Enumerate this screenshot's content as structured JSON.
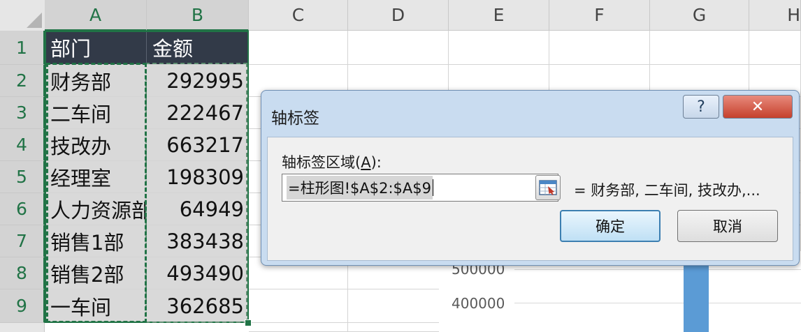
{
  "columns": [
    "A",
    "B",
    "C",
    "D",
    "E",
    "F",
    "G",
    "H"
  ],
  "rows": [
    "1",
    "2",
    "3",
    "4",
    "5",
    "6",
    "7",
    "8",
    "9"
  ],
  "table": {
    "header": [
      "部门",
      "金额"
    ],
    "data": [
      [
        "财务部",
        "292995"
      ],
      [
        "二车间",
        "222467"
      ],
      [
        "技改办",
        "663217"
      ],
      [
        "经理室",
        "198309"
      ],
      [
        "人力资源部",
        "64949"
      ],
      [
        "销售1部",
        "383438"
      ],
      [
        "销售2部",
        "493490"
      ],
      [
        "一车间",
        "362685"
      ]
    ]
  },
  "chart_labels": {
    "tick_top": "500000",
    "tick_mid": "400000"
  },
  "dialog": {
    "title": "轴标签",
    "help_glyph": "?",
    "close_glyph": "✕",
    "field_label_prefix": "轴标签区域(",
    "field_label_key": "A",
    "field_label_suffix": "):",
    "range_value": "=柱形图!$A$2:$A$9",
    "preview": "= 财务部, 二车间, 技改办,...",
    "ok": "确定",
    "cancel": "取消"
  },
  "colors": {
    "accent": "#217346",
    "header_fill": "#323a48",
    "bar": "#5b9bd5"
  }
}
